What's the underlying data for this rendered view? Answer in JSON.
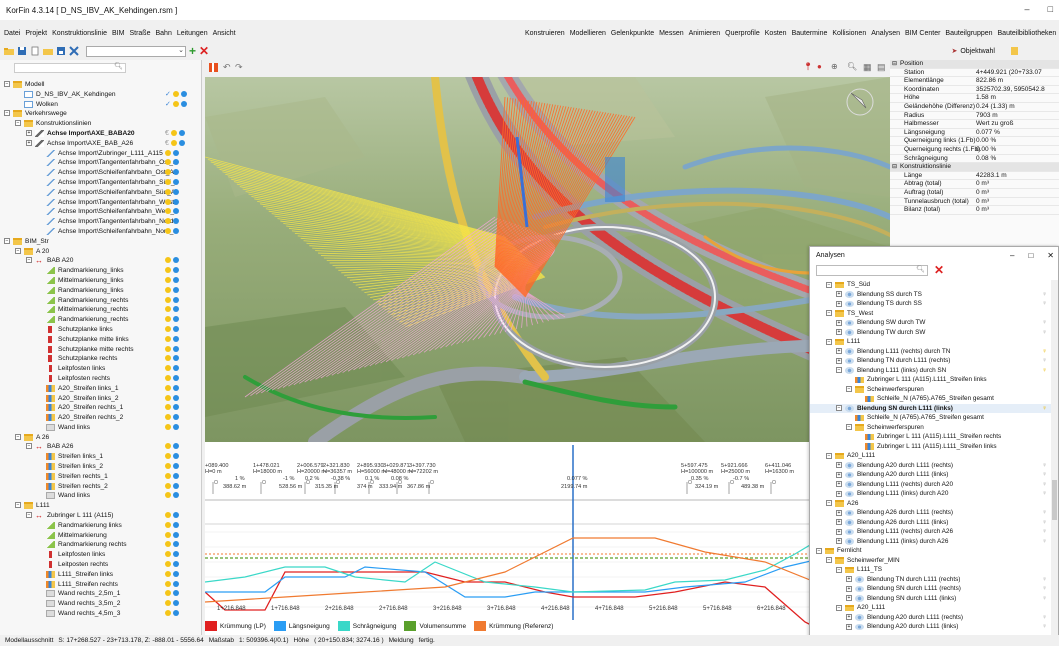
{
  "window": {
    "title": "KorFin 4.3.14 [ D_NS_IBV_AK_Kehdingen.rsm ]",
    "min": "–",
    "max": "□"
  },
  "menu_left": [
    "Datei",
    "Projekt",
    "Konstruktionslinie",
    "BIM",
    "Straße",
    "Bahn",
    "Leitungen",
    "Ansicht"
  ],
  "menu_right": [
    "Konstruieren",
    "Modellieren",
    "Gelenkpunkte",
    "Messen",
    "Animieren",
    "Querprofile",
    "Kosten",
    "Bautermine",
    "Kollisionen",
    "Analysen",
    "BIM Center",
    "Bauteilgruppen",
    "Bauteilbibliotheken"
  ],
  "toolbar": {
    "objektwahl": "Objektwahl"
  },
  "tree": [
    {
      "l": "Modell",
      "d": 0,
      "exp": "-",
      "icon": "folder"
    },
    {
      "l": "D_NS_IBV_AK_Kehdingen",
      "d": 1,
      "icon": "model",
      "status": [
        "check",
        "bulb",
        "blue"
      ]
    },
    {
      "l": "Wolken",
      "d": 1,
      "icon": "model",
      "status": [
        "check",
        "bulb",
        "blue"
      ]
    },
    {
      "l": "Verkehrswege",
      "d": 0,
      "exp": "-",
      "icon": "folder"
    },
    {
      "l": "Konstruktionslinien",
      "d": 1,
      "exp": "-",
      "icon": "folder"
    },
    {
      "l": "Achse Import\\AXE_BABA20",
      "d": 2,
      "exp": "+",
      "icon": "axis",
      "bold": true,
      "status": [
        "c",
        "bulb",
        "blue"
      ]
    },
    {
      "l": "Achse Import\\AXE_BAB_A26",
      "d": 2,
      "exp": "+",
      "icon": "axis",
      "status": [
        "c",
        "bulb",
        "blue"
      ]
    },
    {
      "l": "Achse Import\\Zubringer_L111_A115",
      "d": 3,
      "icon": "line",
      "status": [
        "bulb",
        "blue"
      ]
    },
    {
      "l": "Achse Import\\Tangentenfahrbahn_Ost_A",
      "d": 3,
      "icon": "line",
      "status": [
        "bulb",
        "blue"
      ]
    },
    {
      "l": "Achse Import\\Schleifenfahrbahn_Ost_A",
      "d": 3,
      "icon": "line",
      "status": [
        "bulb",
        "blue"
      ]
    },
    {
      "l": "Achse Import\\Tangentenfahrbahn_Süd_",
      "d": 3,
      "icon": "line",
      "status": [
        "bulb",
        "blue"
      ]
    },
    {
      "l": "Achse Import\\Schleifenfahrbahn_Süd_A",
      "d": 3,
      "icon": "line",
      "status": [
        "bulb",
        "blue"
      ]
    },
    {
      "l": "Achse Import\\Tangentenfahrbahn_West",
      "d": 3,
      "icon": "line",
      "status": [
        "bulb",
        "blue"
      ]
    },
    {
      "l": "Achse Import\\Schleifenfahrbahn_West_A",
      "d": 3,
      "icon": "line",
      "status": [
        "bulb",
        "blue"
      ]
    },
    {
      "l": "Achse Import\\Tangentenfahrbahn_Nord",
      "d": 3,
      "icon": "line",
      "status": [
        "bulb",
        "blue"
      ]
    },
    {
      "l": "Achse Import\\Schleifenfahrbahn_Nord_A",
      "d": 3,
      "icon": "line",
      "status": [
        "bulb",
        "blue"
      ]
    },
    {
      "l": "BIM_Str",
      "d": 0,
      "exp": "-",
      "icon": "folder"
    },
    {
      "l": "A 20",
      "d": 1,
      "exp": "-",
      "icon": "folder"
    },
    {
      "l": "BAB A20",
      "d": 2,
      "exp": "-",
      "icon": "road",
      "status": [
        "bulb",
        "blue"
      ]
    },
    {
      "l": "Randmarkierung_links",
      "d": 3,
      "icon": "mark",
      "status": [
        "bulb",
        "blue"
      ]
    },
    {
      "l": "Mittelmarkierung_links",
      "d": 3,
      "icon": "mark",
      "status": [
        "bulb",
        "blue"
      ]
    },
    {
      "l": "Randmarkierung_links",
      "d": 3,
      "icon": "mark",
      "status": [
        "bulb",
        "blue"
      ]
    },
    {
      "l": "Randmarkierung_rechts",
      "d": 3,
      "icon": "mark",
      "status": [
        "bulb",
        "blue"
      ]
    },
    {
      "l": "Mittelmarkierung_rechts",
      "d": 3,
      "icon": "mark",
      "status": [
        "bulb",
        "blue"
      ]
    },
    {
      "l": "Randmarkierung_rechts",
      "d": 3,
      "icon": "mark",
      "status": [
        "bulb",
        "blue"
      ]
    },
    {
      "l": "Schutzplanke links",
      "d": 3,
      "icon": "rail",
      "status": [
        "bulb",
        "blue"
      ]
    },
    {
      "l": "Schutzplanke mitte links",
      "d": 3,
      "icon": "rail",
      "status": [
        "bulb",
        "blue"
      ]
    },
    {
      "l": "Schutzplanke mitte rechts",
      "d": 3,
      "icon": "rail",
      "status": [
        "bulb",
        "blue"
      ]
    },
    {
      "l": "Schutzplanke rechts",
      "d": 3,
      "icon": "rail",
      "status": [
        "bulb",
        "blue"
      ]
    },
    {
      "l": "Leitpfosten links",
      "d": 3,
      "icon": "post",
      "status": [
        "bulb",
        "blue"
      ]
    },
    {
      "l": "Leitpfosten rechts",
      "d": 3,
      "icon": "post",
      "status": [
        "bulb",
        "blue"
      ]
    },
    {
      "l": "A20_Streifen links_1",
      "d": 3,
      "icon": "lane",
      "status": [
        "bulb",
        "blue"
      ]
    },
    {
      "l": "A20_Streifen links_2",
      "d": 3,
      "icon": "lane",
      "status": [
        "bulb",
        "blue"
      ]
    },
    {
      "l": "A20_Streifen rechts_1",
      "d": 3,
      "icon": "lane",
      "status": [
        "bulb",
        "blue"
      ]
    },
    {
      "l": "A20_Streifen rechts_2",
      "d": 3,
      "icon": "lane",
      "status": [
        "bulb",
        "blue"
      ]
    },
    {
      "l": "Wand links",
      "d": 3,
      "icon": "wall",
      "status": [
        "bulb",
        "blue"
      ]
    },
    {
      "l": "A 26",
      "d": 1,
      "exp": "-",
      "icon": "folder"
    },
    {
      "l": "BAB A26",
      "d": 2,
      "exp": "-",
      "icon": "road",
      "status": [
        "bulb",
        "blue"
      ]
    },
    {
      "l": "Streifen links_1",
      "d": 3,
      "icon": "lane",
      "status": [
        "bulb",
        "blue"
      ]
    },
    {
      "l": "Streifen links_2",
      "d": 3,
      "icon": "lane",
      "status": [
        "bulb",
        "blue"
      ]
    },
    {
      "l": "Streifen rechts_1",
      "d": 3,
      "icon": "lane",
      "status": [
        "bulb",
        "blue"
      ]
    },
    {
      "l": "Streifen rechts_2",
      "d": 3,
      "icon": "lane",
      "status": [
        "bulb",
        "blue"
      ]
    },
    {
      "l": "Wand links",
      "d": 3,
      "icon": "wall",
      "status": [
        "bulb",
        "blue"
      ]
    },
    {
      "l": "L111",
      "d": 1,
      "exp": "-",
      "icon": "folder"
    },
    {
      "l": "Zubringer L 111 (A115)",
      "d": 2,
      "exp": "-",
      "icon": "road",
      "status": [
        "bulb",
        "blue"
      ]
    },
    {
      "l": "Randmarkierung links",
      "d": 3,
      "icon": "mark",
      "status": [
        "bulb",
        "blue"
      ]
    },
    {
      "l": "Mittelmarkierung",
      "d": 3,
      "icon": "mark",
      "status": [
        "bulb",
        "blue"
      ]
    },
    {
      "l": "Randmarkierung rechts",
      "d": 3,
      "icon": "mark",
      "status": [
        "bulb",
        "blue"
      ]
    },
    {
      "l": "Leitpfosten links",
      "d": 3,
      "icon": "post",
      "status": [
        "bulb",
        "blue"
      ]
    },
    {
      "l": "Leitposten rechts",
      "d": 3,
      "icon": "post",
      "status": [
        "bulb",
        "blue"
      ]
    },
    {
      "l": "L111_Streifen links",
      "d": 3,
      "icon": "lane",
      "status": [
        "bulb",
        "blue"
      ]
    },
    {
      "l": "L111_Streifen rechts",
      "d": 3,
      "icon": "lane",
      "status": [
        "bulb",
        "blue"
      ]
    },
    {
      "l": "Wand rechts_2,5m_1",
      "d": 3,
      "icon": "wall",
      "status": [
        "bulb",
        "blue"
      ]
    },
    {
      "l": "Wand rechts_3,5m_2",
      "d": 3,
      "icon": "wall",
      "status": [
        "bulb",
        "blue"
      ]
    },
    {
      "l": "Wand rechts_4,5m_3",
      "d": 3,
      "icon": "wall",
      "status": [
        "bulb",
        "blue"
      ]
    }
  ],
  "props": [
    {
      "h": "Position"
    },
    {
      "k": "Station",
      "v": "4+449.921 (20+733.07"
    },
    {
      "k": "Elementlänge",
      "v": "822.86 m"
    },
    {
      "k": "Koordinaten",
      "v": "3525702.39, 5950542.8"
    },
    {
      "k": "Höhe",
      "v": "1.58 m"
    },
    {
      "k": "Geländehöhe (Differenz)",
      "v": "0.24 (1.33) m"
    },
    {
      "k": "Radius",
      "v": "7903 m"
    },
    {
      "k": "Halbmesser",
      "v": "Wert zu groß"
    },
    {
      "k": "Längsneigung",
      "v": "0.077 %"
    },
    {
      "k": "Querneigung links (1.Fb)",
      "v": "0.00 %"
    },
    {
      "k": "Querneigung rechts (1.Fb)",
      "v": "0.00 %"
    },
    {
      "k": "Schrägneigung",
      "v": "0.08 %"
    },
    {
      "h": "Konstruktionslinie"
    },
    {
      "k": "Länge",
      "v": "42283.1 m"
    },
    {
      "k": "Abtrag (total)",
      "v": "0 m³"
    },
    {
      "k": "Auftrag (total)",
      "v": "0 m³"
    },
    {
      "k": "Tunnelausbruch (total)",
      "v": "0 m³"
    },
    {
      "k": "Bilanz (total)",
      "v": "0 m³"
    }
  ],
  "analysen": {
    "title": "Analysen",
    "rows": [
      {
        "l": "TS_Süd",
        "d": 1,
        "exp": "-",
        "icon": "folder"
      },
      {
        "l": "Blendung SS durch TS",
        "d": 2,
        "exp": "+",
        "icon": "eye",
        "bulb": "grey"
      },
      {
        "l": "Blendung TS durch SS",
        "d": 2,
        "exp": "+",
        "icon": "eye",
        "bulb": "grey"
      },
      {
        "l": "TS_West",
        "d": 1,
        "exp": "-",
        "icon": "folder"
      },
      {
        "l": "Blendung SW durch TW",
        "d": 2,
        "exp": "+",
        "icon": "eye",
        "bulb": "grey"
      },
      {
        "l": "Blendung TW durch SW",
        "d": 2,
        "exp": "+",
        "icon": "eye",
        "bulb": "grey"
      },
      {
        "l": "L111",
        "d": 1,
        "exp": "-",
        "icon": "folder"
      },
      {
        "l": "Blendung L111 (rechts) durch TN",
        "d": 2,
        "exp": "+",
        "icon": "eye",
        "bulb": "yellow"
      },
      {
        "l": "Blendung TN durch L111 (rechts)",
        "d": 2,
        "exp": "+",
        "icon": "eye",
        "bulb": "grey"
      },
      {
        "l": "Blendung L111 (links) durch SN",
        "d": 2,
        "exp": "-",
        "icon": "eye",
        "bulb": "yellow"
      },
      {
        "l": "Zubringer L 111 (A115).L111_Streifen links",
        "d": 3,
        "icon": "lane"
      },
      {
        "l": "Scheinwerferspuren",
        "d": 3,
        "exp": "-",
        "icon": "folder"
      },
      {
        "l": "Schleife_N (A765).A765_Streifen gesamt",
        "d": 4,
        "icon": "lane"
      },
      {
        "l": "Blendung SN durch L111 (links)",
        "d": 2,
        "exp": "-",
        "icon": "eye",
        "bulb": "yellow",
        "bold": true
      },
      {
        "l": "Schleife_N (A765).A765_Streifen gesamt",
        "d": 3,
        "icon": "lane"
      },
      {
        "l": "Scheinwerferspuren",
        "d": 3,
        "exp": "-",
        "icon": "folder"
      },
      {
        "l": "Zubringer L 111 (A115).L111_Streifen rechts",
        "d": 4,
        "icon": "lane"
      },
      {
        "l": "Zubringer L 111 (A115).L111_Streifen links",
        "d": 4,
        "icon": "lane"
      },
      {
        "l": "A20_L111",
        "d": 1,
        "exp": "-",
        "icon": "folder"
      },
      {
        "l": "Blendung A20 durch L111 (rechts)",
        "d": 2,
        "exp": "+",
        "icon": "eye",
        "bulb": "grey"
      },
      {
        "l": "Blendung A20 durch L111 (links)",
        "d": 2,
        "exp": "+",
        "icon": "eye",
        "bulb": "grey"
      },
      {
        "l": "Blendung L111 (rechts) durch A20",
        "d": 2,
        "exp": "+",
        "icon": "eye",
        "bulb": "grey"
      },
      {
        "l": "Blendung L111 (links) durch A20",
        "d": 2,
        "exp": "+",
        "icon": "eye",
        "bulb": "grey"
      },
      {
        "l": "A26",
        "d": 1,
        "exp": "-",
        "icon": "folder"
      },
      {
        "l": "Blendung A26 durch L111 (rechts)",
        "d": 2,
        "exp": "+",
        "icon": "eye",
        "bulb": "grey"
      },
      {
        "l": "Blendung A26 durch L111 (links)",
        "d": 2,
        "exp": "+",
        "icon": "eye",
        "bulb": "grey"
      },
      {
        "l": "Blendung L111 (rechts) durch A26",
        "d": 2,
        "exp": "+",
        "icon": "eye",
        "bulb": "grey"
      },
      {
        "l": "Blendung L111 (links) durch A26",
        "d": 2,
        "exp": "+",
        "icon": "eye",
        "bulb": "grey"
      },
      {
        "l": "Fernlicht",
        "d": 0,
        "exp": "-",
        "icon": "folder"
      },
      {
        "l": "Scheinwerfer_MIN",
        "d": 1,
        "exp": "-",
        "icon": "folder"
      },
      {
        "l": "L111_TS",
        "d": 2,
        "exp": "-",
        "icon": "folder"
      },
      {
        "l": "Blendung TN durch L111 (rechts)",
        "d": 3,
        "exp": "+",
        "icon": "eye",
        "bulb": "grey"
      },
      {
        "l": "Blendung SN durch L111 (rechts)",
        "d": 3,
        "exp": "+",
        "icon": "eye",
        "bulb": "grey"
      },
      {
        "l": "Blendung SN durch L111 (links)",
        "d": 3,
        "exp": "+",
        "icon": "eye",
        "bulb": "grey"
      },
      {
        "l": "A20_L111",
        "d": 2,
        "exp": "-",
        "icon": "folder"
      },
      {
        "l": "Blendung A20 durch L111 (rechts)",
        "d": 3,
        "exp": "+",
        "icon": "eye",
        "bulb": "grey"
      },
      {
        "l": "Blendung A20 durch L111 (links)",
        "d": 3,
        "exp": "+",
        "icon": "eye",
        "bulb": "grey"
      }
    ]
  },
  "profile": {
    "top_labels": [
      {
        "t": "+089.400\nH=0 m"
      },
      {
        "t": "1+478.021\nH=18000 m"
      },
      {
        "t": "2+006.579\nH=20000 m"
      },
      {
        "t": "2+321.830\nH=36357 m"
      },
      {
        "t": "2+895.930\nH=56000 m"
      },
      {
        "t": "3+029.871\nH=48000 m"
      },
      {
        "t": "3+397.730\nH=72202 m"
      },
      {
        "t": "5+597.475\nH=100000 m"
      },
      {
        "t": "5+921.666\nH=25000 m"
      },
      {
        "t": "6+411.046\nH=16300 m"
      }
    ],
    "grade_labels": [
      "1 %",
      "-1 %",
      "0.2 %",
      "-0.38 %",
      "0.1 %",
      "0.08 %",
      "0.077 %",
      "0.35 %",
      "-0.7 %"
    ],
    "length_labels": [
      "388.62 m",
      "528.56 m",
      "315.35 m",
      "374 m",
      "333.94 m",
      "367.86 m",
      "2199.74 m",
      "324.19 m",
      "489.38 m"
    ],
    "stations": [
      "1+216.848",
      "1+716.848",
      "2+216.848",
      "2+716.848",
      "3+216.848",
      "3+716.848",
      "4+216.848",
      "4+716.848",
      "5+216.848",
      "5+716.848",
      "6+216.848",
      "6+7"
    ],
    "legend": [
      {
        "name": "Krümmung (LP)",
        "color": "#e02020"
      },
      {
        "name": "Längsneigung",
        "color": "#2a9df4"
      },
      {
        "name": "Schrägneigung",
        "color": "#3ad8c8"
      },
      {
        "name": "Volumensumme",
        "color": "#5aa02c"
      },
      {
        "name": "Krümmung (Referenz)",
        "color": "#f07a30"
      }
    ]
  },
  "status": [
    "Modellausschnitt",
    "S: 17+268.527 - 23+713.178, Z: -888.01 - 5556.64",
    "Maßstab",
    "1: 509396.4(/0.1)",
    "Höhe",
    "( 20+150.834; 3274.16 )",
    "Meldung",
    "fertig."
  ]
}
